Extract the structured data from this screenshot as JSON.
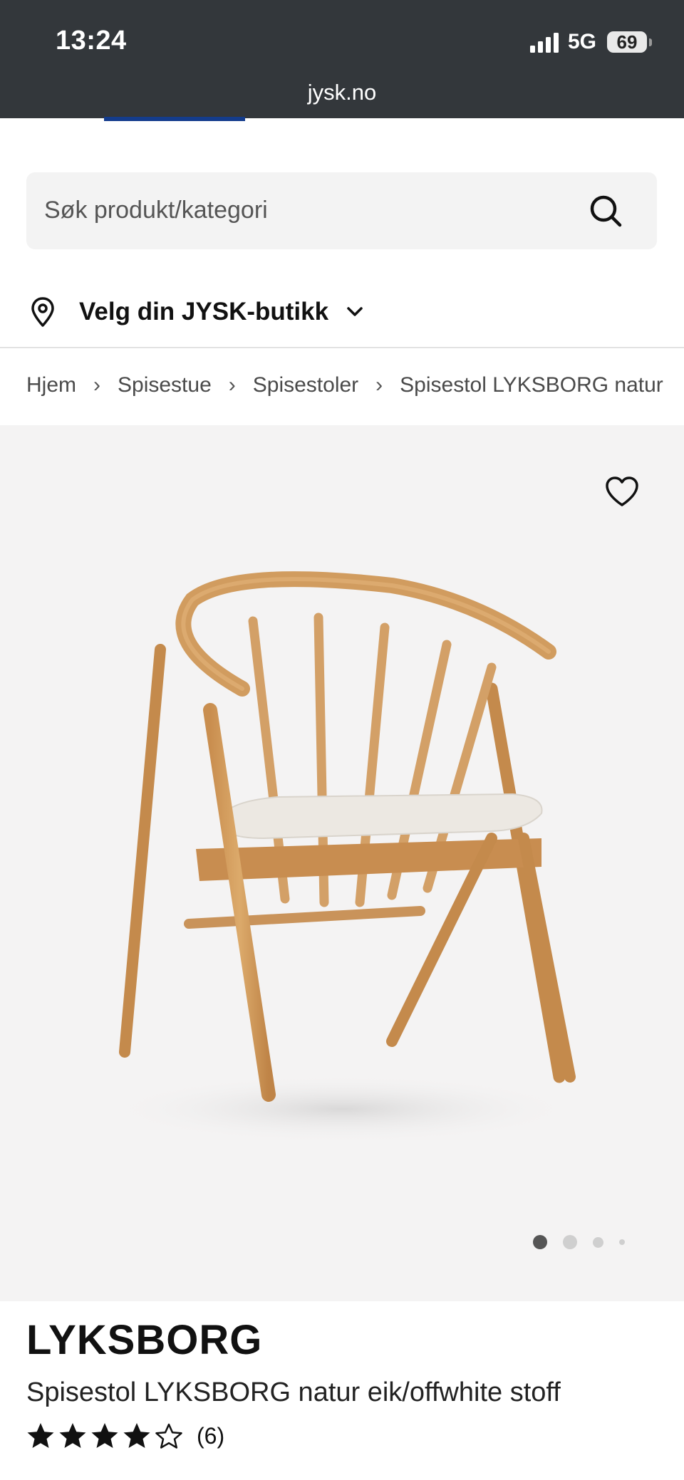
{
  "status_bar": {
    "time": "13:24",
    "network": "5G",
    "battery": "69"
  },
  "browser": {
    "url": "jysk.no"
  },
  "search": {
    "placeholder": "Søk produkt/kategori"
  },
  "store_selector": {
    "label": "Velg din JYSK-butikk"
  },
  "breadcrumb": [
    {
      "label": "Hjem"
    },
    {
      "label": "Spisestue"
    },
    {
      "label": "Spisestoler"
    },
    {
      "label": "Spisestol LYKSBORG natur"
    }
  ],
  "gallery": {
    "image_count": 4,
    "active_index": 0
  },
  "product": {
    "brand": "LYKSBORG",
    "name": "Spisestol LYKSBORG natur eik/offwhite stoff",
    "rating": 4,
    "rating_max": 5,
    "review_count": "(6)"
  },
  "colors": {
    "topbar": "#33373b",
    "accent_blue": "#143c8c",
    "gallery_bg": "#f4f3f3"
  }
}
